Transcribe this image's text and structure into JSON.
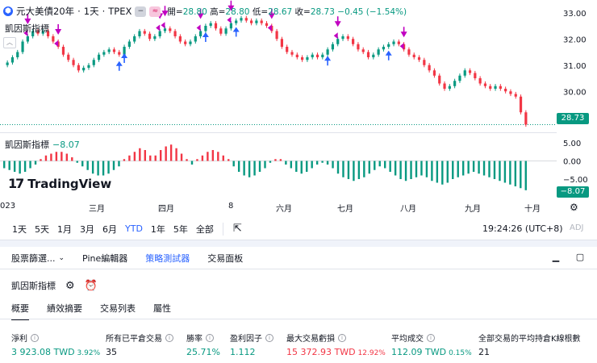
{
  "symbol": {
    "name": "元大美債20年",
    "interval": "1天",
    "exchange": "TPEX",
    "title_sep": " · ",
    "badge_minus": "−",
    "badge_approx": "≈",
    "ohlc": {
      "open_label": "開=",
      "open": "28.80",
      "high_label": "高=",
      "high": "28.80",
      "low_label": "低=",
      "low": "28.67",
      "close_label": "收=",
      "close": "28.73",
      "change": "−0.45 (−1.54%)"
    }
  },
  "price_pane": {
    "indicator_label": "凱因斯指標",
    "axis_ticks": [
      "33.00",
      "32.00",
      "31.00",
      "30.00",
      "29.00"
    ],
    "last_price": "28.73",
    "collapse_icon": "chevron-up-icon"
  },
  "osc_pane": {
    "label": "凱因斯指標",
    "value": "−8.07",
    "axis_ticks": [
      "5.00",
      "0.00",
      "−5.00"
    ],
    "last_value": "−8.07"
  },
  "watermark": {
    "text": "TradingView"
  },
  "time_axis": {
    "labels": [
      "023",
      "三月",
      "四月",
      "8",
      "六月",
      "七月",
      "八月",
      "九月",
      "十月"
    ]
  },
  "range_bar": {
    "buttons": [
      "1天",
      "5天",
      "1月",
      "3月",
      "6月",
      "YTD",
      "1年",
      "5年",
      "全部"
    ],
    "active": "YTD",
    "time": "19:24:26 (UTC+8)",
    "adj": "ADJ"
  },
  "panel_tabs": {
    "items": [
      {
        "label": "股票篩選...",
        "chevron": true
      },
      {
        "label": "Pine編輯器",
        "chevron": false
      },
      {
        "label": "策略測試器",
        "chevron": false
      },
      {
        "label": "交易面板",
        "chevron": false
      }
    ],
    "active": "策略測試器"
  },
  "strategy": {
    "name": "凱因斯指標"
  },
  "subtabs": {
    "items": [
      "概要",
      "績效摘要",
      "交易列表",
      "屬性"
    ],
    "active": "概要"
  },
  "metrics": [
    {
      "label": "淨利",
      "value": "3 923.08 TWD",
      "pct": "3.92%",
      "tone": "up"
    },
    {
      "label": "所有已平倉交易",
      "value": "35",
      "pct": "",
      "tone": "plain"
    },
    {
      "label": "勝率",
      "value": "25.71%",
      "pct": "",
      "tone": "up"
    },
    {
      "label": "盈利因子",
      "value": "1.112",
      "pct": "",
      "tone": "up"
    },
    {
      "label": "最大交易虧損",
      "value": "15 372.93 TWD",
      "pct": "12.92%",
      "tone": "dn"
    },
    {
      "label": "平均成交",
      "value": "112.09 TWD",
      "pct": "0.15%",
      "tone": "up"
    },
    {
      "label": "全部交易的平均持倉K線根數",
      "value": "21",
      "pct": "",
      "tone": "plain"
    }
  ],
  "colors": {
    "up": "#089981",
    "down": "#f23645",
    "accent": "#2962ff",
    "signal": "#c100c1"
  },
  "chart_data": {
    "type": "candlestick",
    "price_ylim": [
      28.5,
      33.3
    ],
    "close_series": [
      31.1,
      31.3,
      31.5,
      31.9,
      32.1,
      32.3,
      32.2,
      32.3,
      32.1,
      31.9,
      31.7,
      31.4,
      31.2,
      31.0,
      30.8,
      30.9,
      31.0,
      31.2,
      31.4,
      31.5,
      31.6,
      31.5,
      31.4,
      31.7,
      31.9,
      32.1,
      32.3,
      32.2,
      32.0,
      32.1,
      32.3,
      32.4,
      32.3,
      32.1,
      31.9,
      31.8,
      31.9,
      32.1,
      32.3,
      32.5,
      32.6,
      32.4,
      32.2,
      32.4,
      32.6,
      32.7,
      32.8,
      32.7,
      32.6,
      32.7,
      32.6,
      32.5,
      32.3,
      32.0,
      31.7,
      31.5,
      31.4,
      31.3,
      31.2,
      31.3,
      31.4,
      31.3,
      31.4,
      31.6,
      31.8,
      32.0,
      32.1,
      32.0,
      31.8,
      31.6,
      31.5,
      31.3,
      31.4,
      31.6,
      31.7,
      31.8,
      31.9,
      31.8,
      31.6,
      31.4,
      31.3,
      31.2,
      31.0,
      30.8,
      30.6,
      30.3,
      30.1,
      30.2,
      30.4,
      30.6,
      30.8,
      30.7,
      30.5,
      30.3,
      30.2,
      30.1,
      30.2,
      30.1,
      30.0,
      29.9,
      29.8,
      29.2,
      28.73
    ],
    "oscillator_series": [
      -2,
      -2.5,
      -3,
      -3.5,
      -3,
      -2,
      -1,
      0.5,
      1.5,
      2,
      2.5,
      2.5,
      2,
      1,
      -0.5,
      -1.5,
      -2.5,
      -3.5,
      -4,
      -4,
      -3.5,
      -2.5,
      -1.5,
      0.5,
      1.5,
      2.5,
      3.5,
      3,
      1.5,
      1.5,
      3,
      4,
      4.5,
      3.5,
      2,
      0.5,
      -1,
      0.5,
      1.5,
      2.5,
      3,
      2.5,
      1.5,
      0.5,
      -1.5,
      -3,
      -4,
      -4.5,
      -4,
      -3,
      -2,
      -0.5,
      0.5,
      0.5,
      -1,
      -2,
      -3,
      -3.5,
      -3,
      -2,
      -1,
      -0.5,
      -1,
      -2,
      -3.5,
      -4.5,
      -5,
      -5.5,
      -5,
      -4.5,
      -3.5,
      -2.5,
      -1.5,
      -2,
      -3,
      -4,
      -5,
      -5.5,
      -5,
      -4.5,
      -4,
      -4.5,
      -5.5,
      -6,
      -6.5,
      -6,
      -5,
      -4.5,
      -4,
      -3.5,
      -3,
      -3.5,
      -4,
      -4.5,
      -5,
      -5.5,
      -6,
      -6.5,
      -7,
      -7.5,
      -8.07
    ],
    "osc_ylim": [
      -9,
      7
    ]
  }
}
